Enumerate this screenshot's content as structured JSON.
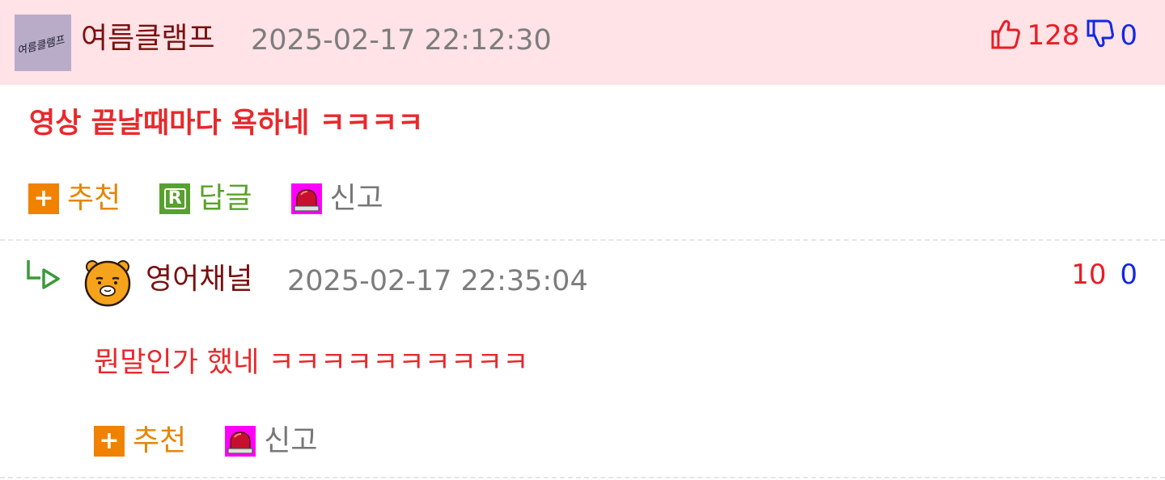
{
  "comment": {
    "author": "여름클램프",
    "avatar_text": "여름클램프",
    "timestamp": "2025-02-17 22:12:30",
    "upvotes": "128",
    "downvotes": "0",
    "text": "영상 끝날때마다 욕하네 ㅋㅋㅋㅋ",
    "actions": {
      "recommend": "추천",
      "reply": "답글",
      "report": "신고"
    }
  },
  "reply": {
    "author": "영어채널",
    "timestamp": "2025-02-17 22:35:04",
    "upvotes": "10",
    "downvotes": "0",
    "text": "뭔말인가 했네 ㅋㅋㅋㅋㅋㅋㅋㅋㅋㅋ",
    "actions": {
      "recommend": "추천",
      "report": "신고"
    }
  },
  "icons": {
    "thumbs_up": "thumbs-up-icon",
    "thumbs_down": "thumbs-down-icon",
    "plus": "plus-icon",
    "reply_r": "reply-icon",
    "siren": "siren-icon",
    "reply_arrow": "reply-arrow-icon"
  },
  "colors": {
    "header_bg": "#ffe3e6",
    "author": "#7a1010",
    "comment_text": "#e8292c",
    "upvote": "#ea1c24",
    "downvote": "#1428e6",
    "recommend": "#e5860a",
    "reply": "#5aa12c",
    "report": "#777777"
  }
}
